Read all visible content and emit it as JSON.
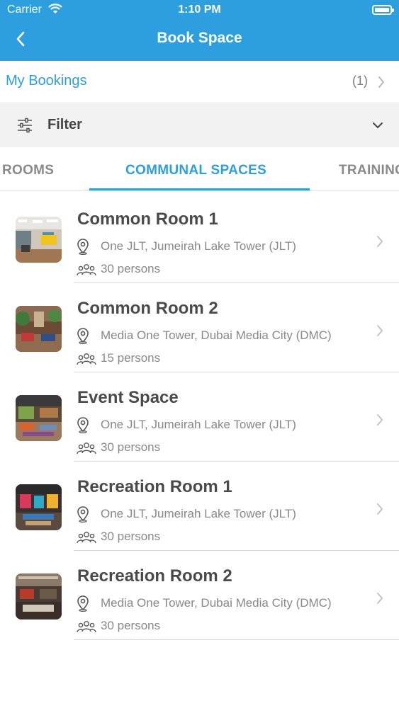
{
  "status_bar": {
    "carrier": "Carrier",
    "time": "1:10 PM"
  },
  "nav": {
    "title": "Book Space",
    "back_icon": "chevron-left-icon"
  },
  "bookings": {
    "label": "My Bookings",
    "count": "(1)"
  },
  "filter": {
    "label": "Filter"
  },
  "tabs": [
    {
      "label": "ROOMS",
      "active": false
    },
    {
      "label": "COMMUNAL SPACES",
      "active": true
    },
    {
      "label": "TRAINING",
      "active": false
    }
  ],
  "spaces": [
    {
      "name": "Common Room 1",
      "location": "One JLT, Jumeirah Lake Tower (JLT)",
      "capacity": "30 persons"
    },
    {
      "name": "Common Room 2",
      "location": "Media One Tower, Dubai Media City (DMC)",
      "capacity": "15 persons"
    },
    {
      "name": "Event Space",
      "location": "One JLT, Jumeirah Lake Tower (JLT)",
      "capacity": "30 persons"
    },
    {
      "name": "Recreation Room 1",
      "location": "One JLT, Jumeirah Lake Tower (JLT)",
      "capacity": "30 persons"
    },
    {
      "name": "Recreation Room 2",
      "location": "Media One Tower, Dubai Media City (DMC)",
      "capacity": "30 persons"
    }
  ],
  "colors": {
    "accent": "#2d9fdf",
    "filter_bg": "#f2f2f2",
    "text": "#4a4a4a",
    "muted": "#888888"
  }
}
